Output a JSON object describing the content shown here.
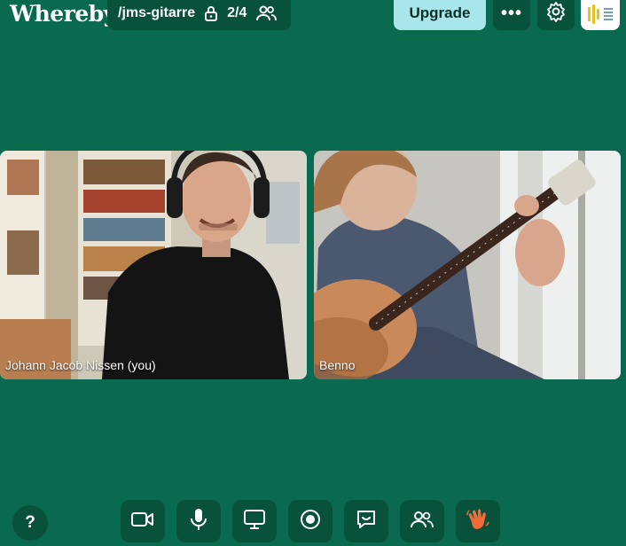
{
  "brand": {
    "logo": "Whereby"
  },
  "room": {
    "name": "/jms-gitarre",
    "participant_count": "2/4"
  },
  "header": {
    "upgrade_label": "Upgrade",
    "more_label": "•••"
  },
  "participants": [
    {
      "name": "Johann Jacob Nissen (you)"
    },
    {
      "name": "Benno"
    }
  ],
  "toolbar": {
    "help_label": "?",
    "buttons": [
      "camera",
      "microphone",
      "screenshare",
      "record",
      "chat",
      "people",
      "raise-hand"
    ]
  },
  "colors": {
    "background": "#0a6a4f",
    "button": "#08523c",
    "upgrade": "#a9e6ec",
    "hand": "#f26b3a"
  }
}
